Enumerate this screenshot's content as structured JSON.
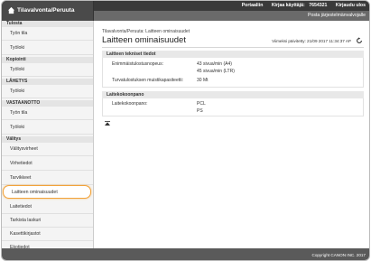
{
  "header": {
    "home_title": "Tilavalvonta/Peruuta",
    "links": [
      "Portaaliin",
      "Kirjaa käyttäjä:",
      "7654321",
      "Kirjaudu ulos"
    ],
    "email_link": "Posta järjestelmänvalvojalle"
  },
  "sidebar": {
    "sections": [
      {
        "label": "Tulosta",
        "items": [
          "Työn tila",
          "Työloki"
        ]
      },
      {
        "label": "Kopiointi",
        "items": [
          "Työloki"
        ]
      },
      {
        "label": "LÄHETYS",
        "items": [
          "Työloki"
        ]
      },
      {
        "label": "VASTAANOTTO",
        "items": [
          "Työn tila",
          "Työloki"
        ]
      },
      {
        "label": "Välitys",
        "items": [
          "Välitysvirheet",
          "Virhetiedot",
          "Tarvikkeet",
          "Laitteen ominaisuudet",
          "Laitetiedot",
          "Tarkista laskuri",
          "Kasettikirjastot",
          "Ekotiedot"
        ]
      }
    ],
    "active_item": "Laitteen ominaisuudet"
  },
  "main": {
    "breadcrumb": "Tilavalvonta/Peruuta: Laitteen ominaisuudet",
    "title": "Laitteen ominaisuudet",
    "updated": "Viimeksi päivitetty: 21/09 2017 11:34:37 AP",
    "specs_section": {
      "title": "Laitteen tekniset tiedot",
      "rows": [
        {
          "label": "Enimmäistulostusnopeus:",
          "values": [
            "43 sivua/min (A4)",
            "45 sivua/min (LTR)"
          ]
        },
        {
          "label": "Turvatulostuksen muistikapasiteetti:",
          "values": [
            "30 Mt"
          ]
        }
      ]
    },
    "language_section": {
      "title": "Laitekokoonpano",
      "rows": [
        {
          "label": "Laitekokoonpano:",
          "values": [
            "PCL",
            "PS"
          ]
        }
      ]
    }
  },
  "footer": {
    "copyright": "Copyright CANON INC. 2017"
  },
  "colors": {
    "header": "#5a5a5a",
    "highlight": "#f2a33a"
  }
}
